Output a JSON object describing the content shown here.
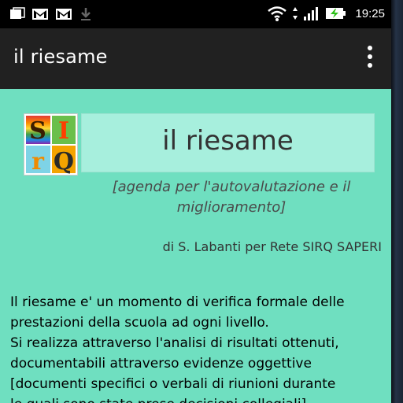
{
  "status_bar": {
    "time": "19:25"
  },
  "action_bar": {
    "title": "il riesame"
  },
  "logo": {
    "letters": [
      "S",
      "I",
      "r",
      "Q"
    ]
  },
  "header": {
    "title": "il riesame"
  },
  "subtitle": {
    "line1": "[agenda per l'autovalutazione e il",
    "line2": "miglioramento]"
  },
  "author": "di S. Labanti per Rete SIRQ SAPERI",
  "body": {
    "lines": [
      "Il riesame e' un momento di verifica formale delle",
      "prestazioni della scuola ad ogni livello.",
      "Si realizza attraverso l'analisi di risultati ottenuti,",
      "documentabili attraverso evidenze oggettive",
      "[documenti specifici o verbali di riunioni durante",
      "le quali sono state prese decisioni collegiali]"
    ]
  },
  "colors": {
    "background": "#6fdfc0",
    "header_box": "#a7efdd",
    "action_bar": "#212121",
    "status_bar": "#000000"
  }
}
